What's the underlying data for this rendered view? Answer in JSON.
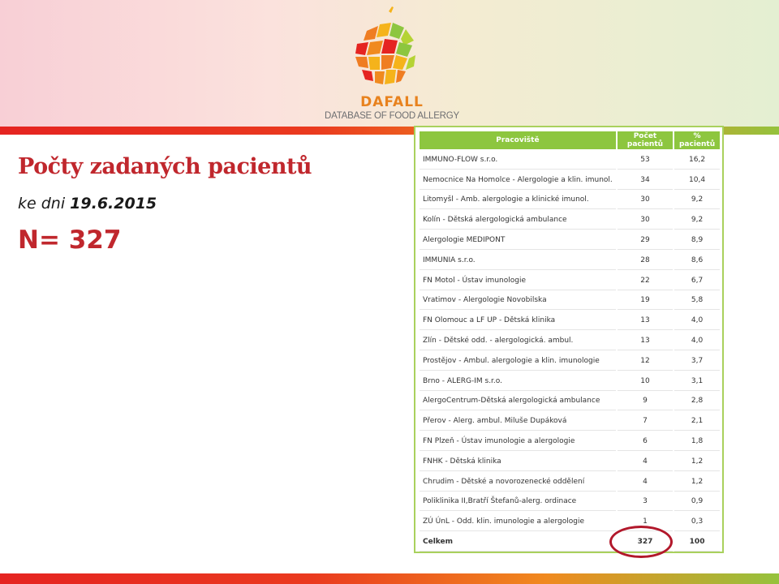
{
  "logo": {
    "name": "DAFALL",
    "tagline": "DATABASE OF FOOD ALLERGY",
    "colors": {
      "orange": "#ef7d22",
      "red": "#e52421",
      "green": "#8dc63f",
      "yellow": "#f5b31b"
    }
  },
  "slide": {
    "title": "Počty zadaných pacientů",
    "date_label": "ke dni",
    "date_value": "19.6.2015",
    "total_label": "N= 327"
  },
  "table": {
    "headers": [
      "Pracoviště",
      "Počet pacientů",
      "% pacientů"
    ],
    "rows": [
      {
        "name": "IMMUNO-FLOW s.r.o.",
        "count": "53",
        "pct": "16,2"
      },
      {
        "name": "Nemocnice Na Homolce - Alergologie a klin. imunol.",
        "count": "34",
        "pct": "10,4"
      },
      {
        "name": "Litomyšl - Amb. alergologie a klinické imunol.",
        "count": "30",
        "pct": "9,2"
      },
      {
        "name": "Kolín - Dětská alergologická ambulance",
        "count": "30",
        "pct": "9,2"
      },
      {
        "name": "Alergologie MEDIPONT",
        "count": "29",
        "pct": "8,9"
      },
      {
        "name": "IMMUNIA s.r.o.",
        "count": "28",
        "pct": "8,6"
      },
      {
        "name": "FN Motol - Ústav imunologie",
        "count": "22",
        "pct": "6,7"
      },
      {
        "name": "Vratimov - Alergologie Novobilska",
        "count": "19",
        "pct": "5,8"
      },
      {
        "name": "FN Olomouc a LF UP - Dětská klinika",
        "count": "13",
        "pct": "4,0"
      },
      {
        "name": "Zlín - Dětské odd. - alergologická. ambul.",
        "count": "13",
        "pct": "4,0"
      },
      {
        "name": "Prostějov - Ambul. alergologie a klin. imunologie",
        "count": "12",
        "pct": "3,7"
      },
      {
        "name": "Brno - ALERG-IM s.r.o.",
        "count": "10",
        "pct": "3,1"
      },
      {
        "name": "AlergoCentrum-Dětská alergologická ambulance",
        "count": "9",
        "pct": "2,8"
      },
      {
        "name": "Přerov - Alerg. ambul. Miluše Dupáková",
        "count": "7",
        "pct": "2,1"
      },
      {
        "name": "FN Plzeň - Ústav imunologie a alergologie",
        "count": "6",
        "pct": "1,8"
      },
      {
        "name": "FNHK - Dětská klinika",
        "count": "4",
        "pct": "1,2"
      },
      {
        "name": "Chrudim - Dětské a novorozenecké oddělení",
        "count": "4",
        "pct": "1,2"
      },
      {
        "name": "Poliklinika II,Bratří Štefanů-alerg. ordinace",
        "count": "3",
        "pct": "0,9"
      },
      {
        "name": "ZÚ ÚnL - Odd. klin. imunologie a alergologie",
        "count": "1",
        "pct": "0,3"
      }
    ],
    "total": {
      "name": "Celkem",
      "count": "327",
      "pct": "100"
    }
  },
  "colors": {
    "accent_red": "#c0272d",
    "header_green": "#8dc63f",
    "highlight_circle": "#b2182b"
  }
}
